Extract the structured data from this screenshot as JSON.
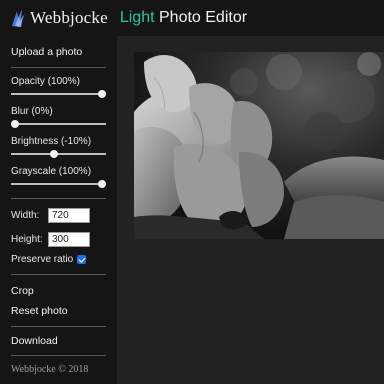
{
  "brand": {
    "name": "Webbjocke"
  },
  "app_title": {
    "light": "Light",
    "rest": "Photo Editor"
  },
  "sidebar": {
    "upload_label": "Upload a photo",
    "sliders": [
      {
        "label": "Opacity (100%)",
        "value_percent": 100
      },
      {
        "label": "Blur (0%)",
        "value_percent": 0
      },
      {
        "label": "Brightness (-10%)",
        "value_percent": 45
      },
      {
        "label": "Grayscale (100%)",
        "value_percent": 100
      }
    ],
    "width": {
      "label": "Width:",
      "value": "720"
    },
    "height": {
      "label": "Height:",
      "value": "300"
    },
    "preserve_ratio": {
      "label": "Preserve ratio",
      "checked": true
    },
    "crop_label": "Crop",
    "reset_label": "Reset photo",
    "download_label": "Download",
    "copyright": "Webbjocke © 2018"
  },
  "colors": {
    "accent": "#2ec4a3",
    "checkbox": "#1e6fe0",
    "background": "#222222",
    "panel": "#151515"
  }
}
